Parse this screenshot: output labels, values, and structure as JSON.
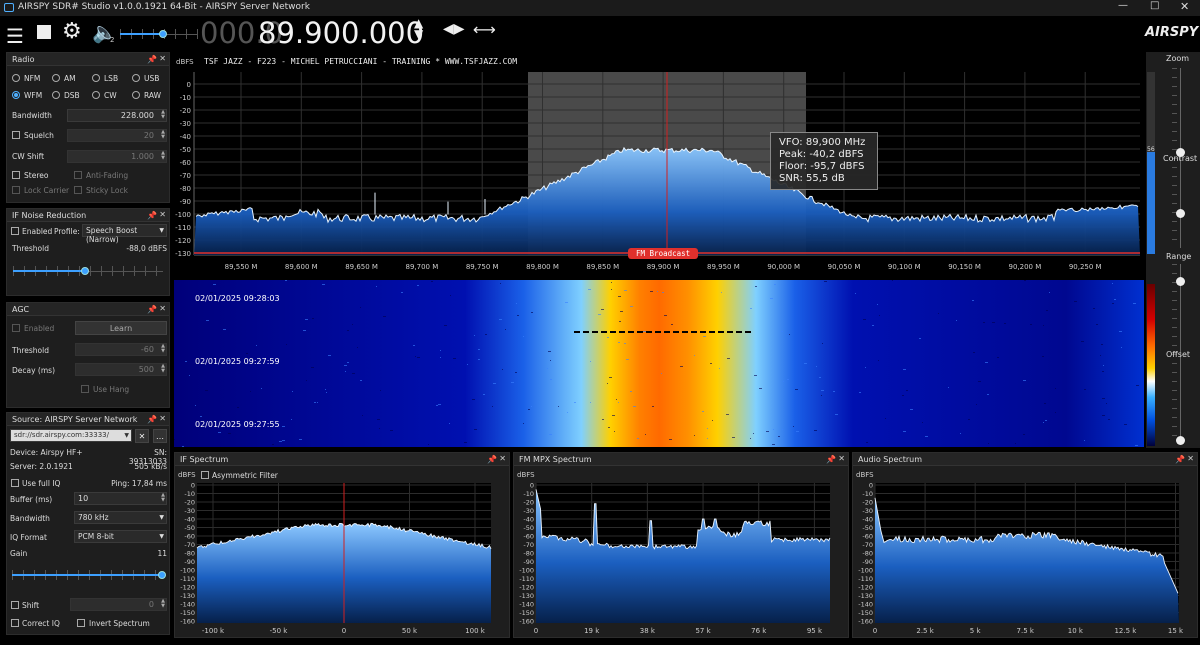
{
  "window": {
    "title": "AIRSPY SDR# Studio v1.0.0.1921 64-Bit - AIRSPY Server Network"
  },
  "toolbar": {
    "freq_dim": "000.0",
    "freq_bright": "89.900.000",
    "volume_mark": "2",
    "volume_level": 0.55,
    "brand": "AIRSPY"
  },
  "radio": {
    "title": "Radio",
    "modes": [
      "NFM",
      "AM",
      "LSB",
      "USB",
      "WFM",
      "DSB",
      "CW",
      "RAW"
    ],
    "selected_mode": "WFM",
    "bandwidth_label": "Bandwidth",
    "bandwidth_value": "228.000",
    "squelch_label": "Squelch",
    "squelch_value": "20",
    "cw_shift_label": "CW Shift",
    "cw_shift_value": "1.000",
    "stereo_label": "Stereo",
    "anti_fading_label": "Anti-Fading",
    "lock_carrier_label": "Lock Carrier",
    "sticky_lock_label": "Sticky Lock"
  },
  "if_noise": {
    "title": "IF Noise Reduction",
    "enabled_label": "Enabled",
    "profile_label": "Profile:",
    "profile_value": "Speech Boost (Narrow)",
    "threshold_label": "Threshold",
    "threshold_value": "-88,0 dBFS",
    "threshold_level": 0.48
  },
  "agc": {
    "title": "AGC",
    "enabled_label": "Enabled",
    "learn_label": "Learn",
    "threshold_label": "Threshold",
    "threshold_value": "-60",
    "decay_label": "Decay (ms)",
    "decay_value": "500",
    "use_hang_label": "Use Hang"
  },
  "source": {
    "title": "Source: AIRSPY Server Network",
    "url": "sdr://sdr.airspy.com:33333/",
    "device_label": "Device: Airspy HF+",
    "sn_label": "SN: 39313033",
    "server_label": "Server: 2.0.1921",
    "rate_label": "505 kB/s",
    "use_full_iq_label": "Use full IQ",
    "ping_label": "Ping: 17,84 ms",
    "buffer_label": "Buffer (ms)",
    "buffer_value": "10",
    "bandwidth_label": "Bandwidth",
    "bandwidth_value": "780 kHz",
    "iq_format_label": "IQ Format",
    "iq_format_value": "PCM 8-bit",
    "gain_label": "Gain",
    "gain_value": "11",
    "gain_level": 1.0,
    "shift_label": "Shift",
    "shift_value": "0",
    "correct_iq_label": "Correct IQ",
    "invert_label": "Invert Spectrum"
  },
  "spectrum": {
    "unit_label": "dBFS",
    "station_text": "TSF JAZZ - F223 - MICHEL PETRUCCIANI - TRAINING * WWW.TSFJAZZ.COM",
    "band_label": "FM Broadcast",
    "y_ticks": [
      "0",
      "-10",
      "-20",
      "-30",
      "-40",
      "-50",
      "-60",
      "-70",
      "-80",
      "-90",
      "-100",
      "-110",
      "-120",
      "-130"
    ],
    "x_ticks": [
      "89,550 M",
      "89,600 M",
      "89,650 M",
      "89,700 M",
      "89,750 M",
      "89,800 M",
      "89,850 M",
      "89,900 M",
      "89,950 M",
      "90,000 M",
      "90,050 M",
      "90,100 M",
      "90,150 M",
      "90,200 M",
      "90,250 M"
    ],
    "vfo_tip": {
      "vfo_label": "VFO:",
      "vfo_value": "89,900 MHz",
      "peak_label": "Peak:",
      "peak_value": "-40,2 dBFS",
      "floor_label": "Floor:",
      "floor_value": "-95,7 dBFS",
      "snr_label": "SNR:",
      "snr_value": "55,5 dB"
    }
  },
  "waterfall": {
    "timestamps": [
      "02/01/2025 09:28:03",
      "02/01/2025 09:27:59",
      "02/01/2025 09:27:55"
    ]
  },
  "right_sliders": {
    "zoom_label": "Zoom",
    "contrast_label": "Contrast",
    "range_label": "Range",
    "offset_label": "Offset",
    "meter_value": "56"
  },
  "if_spectrum": {
    "title": "IF Spectrum",
    "asym_label": "Asymmetric Filter",
    "unit_label": "dBFS",
    "y_ticks": [
      "0",
      "-10",
      "-20",
      "-30",
      "-40",
      "-50",
      "-60",
      "-70",
      "-80",
      "-90",
      "-100",
      "-110",
      "-120",
      "-130",
      "-140",
      "-150",
      "-160"
    ],
    "x_ticks": [
      "-100 k",
      "-50 k",
      "0",
      "50 k",
      "100 k"
    ]
  },
  "fm_mpx": {
    "title": "FM MPX Spectrum",
    "unit_label": "dBFS",
    "y_ticks": [
      "0",
      "-10",
      "-20",
      "-30",
      "-40",
      "-50",
      "-60",
      "-70",
      "-80",
      "-90",
      "-100",
      "-110",
      "-120",
      "-130",
      "-140",
      "-150",
      "-160"
    ],
    "x_ticks": [
      "0",
      "19 k",
      "38 k",
      "57 k",
      "76 k",
      "95 k"
    ]
  },
  "audio": {
    "title": "Audio Spectrum",
    "unit_label": "dBFS",
    "y_ticks": [
      "0",
      "-10",
      "-20",
      "-30",
      "-40",
      "-50",
      "-60",
      "-70",
      "-80",
      "-90",
      "-100",
      "-110",
      "-120",
      "-130",
      "-140",
      "-150",
      "-160"
    ],
    "x_ticks": [
      "0",
      "2.5 k",
      "5 k",
      "7.5 k",
      "10 k",
      "12.5 k",
      "15 k"
    ]
  },
  "colors": {
    "accent": "#3da0ff",
    "band": "#e0302c",
    "vfo": "#d02020"
  }
}
